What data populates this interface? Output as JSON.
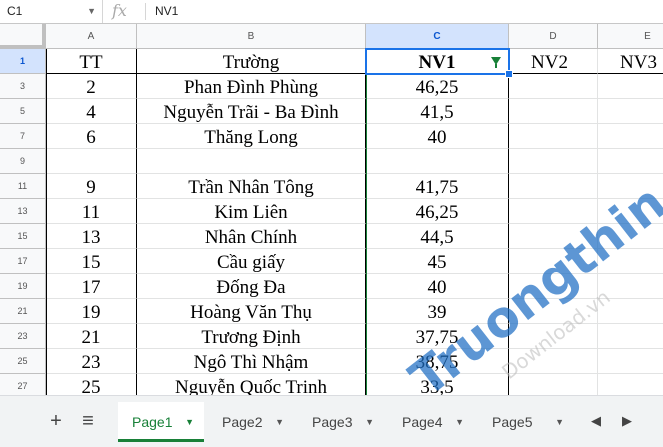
{
  "formula_bar": {
    "cell_ref": "C1",
    "fx_label": "fx",
    "value": "NV1"
  },
  "columns": [
    "A",
    "B",
    "C",
    "D",
    "E"
  ],
  "selected_column": "C",
  "rows": [
    {
      "num": "1",
      "cells": [
        "TT",
        "Trường",
        "NV1",
        "NV2",
        "NV3"
      ]
    },
    {
      "num": "3",
      "cells": [
        "2",
        "Phan Đình Phùng",
        "46,25",
        "",
        ""
      ]
    },
    {
      "num": "5",
      "cells": [
        "4",
        "Nguyễn Trãi - Ba Đình",
        "41,5",
        "",
        ""
      ]
    },
    {
      "num": "7",
      "cells": [
        "6",
        "Thăng Long",
        "40",
        "",
        ""
      ]
    },
    {
      "num": "9",
      "cells": [
        "",
        "",
        "",
        "",
        ""
      ]
    },
    {
      "num": "11",
      "cells": [
        "9",
        "Trần Nhân Tông",
        "41,75",
        "",
        ""
      ]
    },
    {
      "num": "13",
      "cells": [
        "11",
        "Kim Liên",
        "46,25",
        "",
        ""
      ]
    },
    {
      "num": "15",
      "cells": [
        "13",
        "Nhân Chính",
        "44,5",
        "",
        ""
      ]
    },
    {
      "num": "17",
      "cells": [
        "15",
        "Cầu giấy",
        "45",
        "",
        ""
      ]
    },
    {
      "num": "19",
      "cells": [
        "17",
        "Đống Đa",
        "40",
        "",
        ""
      ]
    },
    {
      "num": "21",
      "cells": [
        "19",
        "Hoàng Văn Thụ",
        "39",
        "",
        ""
      ]
    },
    {
      "num": "23",
      "cells": [
        "21",
        "Trương Định",
        "37,75",
        "",
        ""
      ]
    },
    {
      "num": "25",
      "cells": [
        "23",
        "Ngô Thì Nhậm",
        "38,75",
        "",
        ""
      ]
    },
    {
      "num": "27",
      "cells": [
        "25",
        "Nguyễn Quốc Trinh",
        "33,5",
        "",
        ""
      ]
    }
  ],
  "sheet_tabs": {
    "add_label": "+",
    "list_label": "≡",
    "tabs": [
      "Page1",
      "Page2",
      "Page3",
      "Page4",
      "Page5"
    ],
    "active": "Page1",
    "dropdown_glyph": "▼",
    "left_arrow": "◀",
    "right_arrow": "▶"
  },
  "watermark": {
    "brand": "Truongthin.top",
    "sub": "Download.vn"
  },
  "colors": {
    "accent_green": "#188038",
    "selection_blue": "#1a73e8",
    "header_selected": "#d3e3fd",
    "watermark_blue": "#1f6fc4",
    "watermark_red": "#e64a3b"
  }
}
